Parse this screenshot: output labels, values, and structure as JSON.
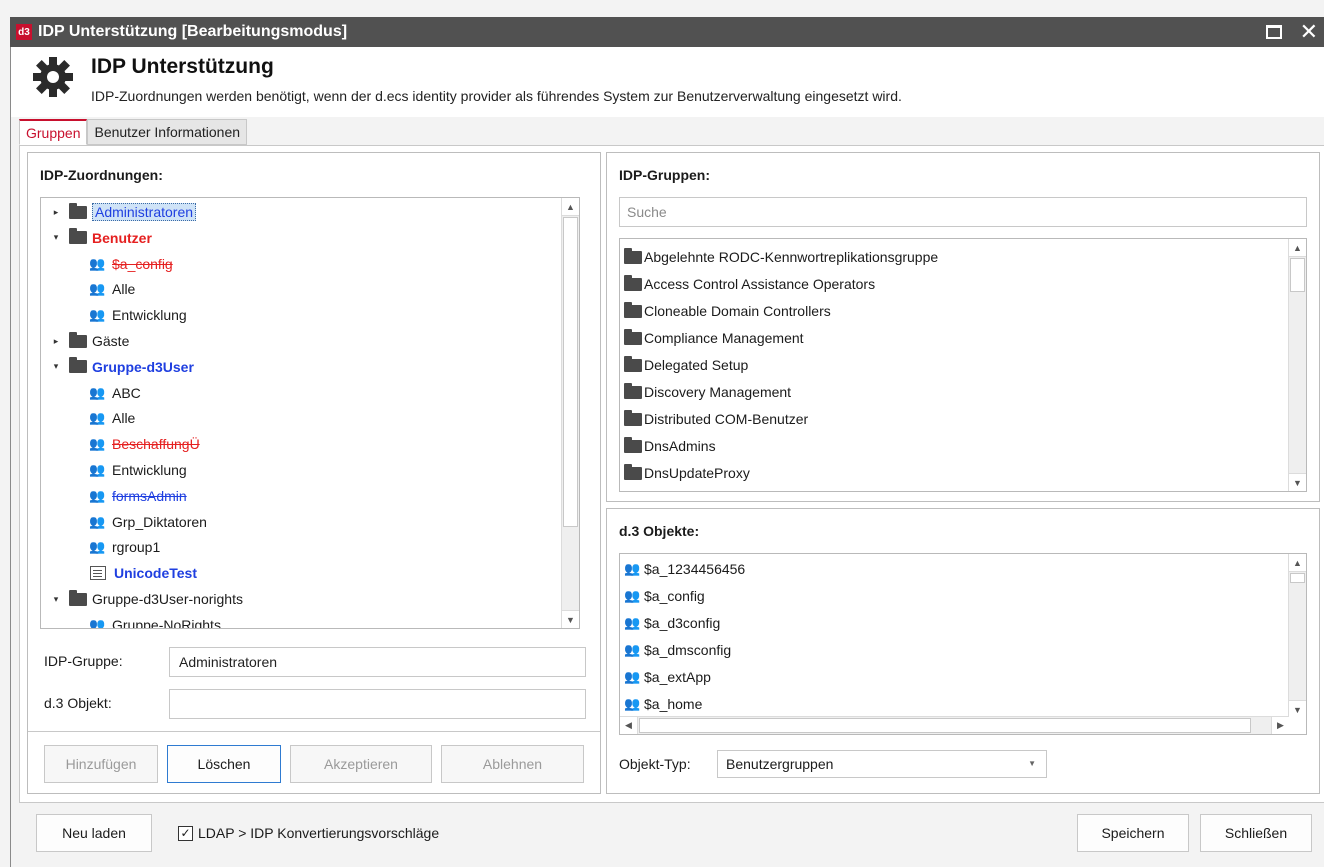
{
  "window": {
    "logo": "d3",
    "title": "IDP Unterstützung [Bearbeitungsmodus]"
  },
  "header": {
    "title": "IDP Unterstützung",
    "description": "IDP-Zuordnungen werden benötigt, wenn der d.ecs identity provider als führendes System zur Benutzerverwaltung eingesetzt wird."
  },
  "tabs": [
    {
      "label": "Gruppen",
      "active": true
    },
    {
      "label": "Benutzer Informationen",
      "active": false
    }
  ],
  "mappings": {
    "title": "IDP-Zuordnungen:",
    "tree": [
      {
        "label": "Administratoren",
        "level": 0,
        "icon": "folder-icon",
        "arrow": "▸",
        "style": "selected"
      },
      {
        "label": "Benutzer",
        "level": 0,
        "icon": "folder-icon",
        "arrow": "▾",
        "style": "red"
      },
      {
        "label": "$a_config",
        "level": 1,
        "icon": "group-icon",
        "arrow": "",
        "style": "red-strike"
      },
      {
        "label": "Alle",
        "level": 1,
        "icon": "group-icon",
        "arrow": "",
        "style": "normal"
      },
      {
        "label": "Entwicklung",
        "level": 1,
        "icon": "group-icon",
        "arrow": "",
        "style": "normal"
      },
      {
        "label": "Gäste",
        "level": 0,
        "icon": "folder-icon",
        "arrow": "▸",
        "style": "normal"
      },
      {
        "label": "Gruppe-d3User",
        "level": 0,
        "icon": "folder-icon",
        "arrow": "▾",
        "style": "blue"
      },
      {
        "label": "ABC",
        "level": 1,
        "icon": "group-icon",
        "arrow": "",
        "style": "normal"
      },
      {
        "label": "Alle",
        "level": 1,
        "icon": "group-icon",
        "arrow": "",
        "style": "normal"
      },
      {
        "label": "BeschaffungÜ",
        "level": 1,
        "icon": "group-icon",
        "arrow": "",
        "style": "red-strike"
      },
      {
        "label": "Entwicklung",
        "level": 1,
        "icon": "group-icon",
        "arrow": "",
        "style": "normal"
      },
      {
        "label": "formsAdmin",
        "level": 1,
        "icon": "group-icon",
        "arrow": "",
        "style": "blue-strike"
      },
      {
        "label": "Grp_Diktatoren",
        "level": 1,
        "icon": "group-icon",
        "arrow": "",
        "style": "normal"
      },
      {
        "label": "rgroup1",
        "level": 1,
        "icon": "group-icon",
        "arrow": "",
        "style": "normal"
      },
      {
        "label": "UnicodeTest",
        "level": 1,
        "icon": "document-icon",
        "arrow": "",
        "style": "blue"
      },
      {
        "label": "Gruppe-d3User-norights",
        "level": 0,
        "icon": "folder-icon",
        "arrow": "▾",
        "style": "normal"
      },
      {
        "label": "Gruppe-NoRights",
        "level": 1,
        "icon": "group-icon",
        "arrow": "",
        "style": "normal"
      }
    ],
    "idp_group_label": "IDP-Gruppe:",
    "idp_group_value": "Administratoren",
    "d3_object_label": "d.3 Objekt:",
    "d3_object_value": "",
    "buttons": {
      "add": "Hinzufügen",
      "delete": "Löschen",
      "accept": "Akzeptieren",
      "reject": "Ablehnen"
    }
  },
  "idp_groups": {
    "title": "IDP-Gruppen:",
    "search_placeholder": "Suche",
    "items": [
      "Abgelehnte RODC-Kennwortreplikationsgruppe",
      "Access Control Assistance Operators",
      "Cloneable Domain Controllers",
      "Compliance Management",
      "Delegated Setup",
      "Discovery Management",
      "Distributed COM-Benutzer",
      "DnsAdmins",
      "DnsUpdateProxy"
    ]
  },
  "d3_objects": {
    "title": "d.3 Objekte:",
    "items": [
      "$a_1234456456",
      "$a_config",
      "$a_d3config",
      "$a_dmsconfig",
      "$a_extApp",
      "$a_home"
    ],
    "type_label": "Objekt-Typ:",
    "type_value": "Benutzergruppen"
  },
  "footer": {
    "reload": "Neu laden",
    "ldap_checkbox_label": "LDAP > IDP Konvertierungsvorschläge",
    "ldap_checked": true,
    "save": "Speichern",
    "close": "Schließen"
  },
  "colors": {
    "titlebar": "#515151",
    "brand_red": "#c8102e",
    "error_red": "#e52020",
    "link_blue": "#1f3fe0",
    "selection": "#cfe3f7"
  }
}
